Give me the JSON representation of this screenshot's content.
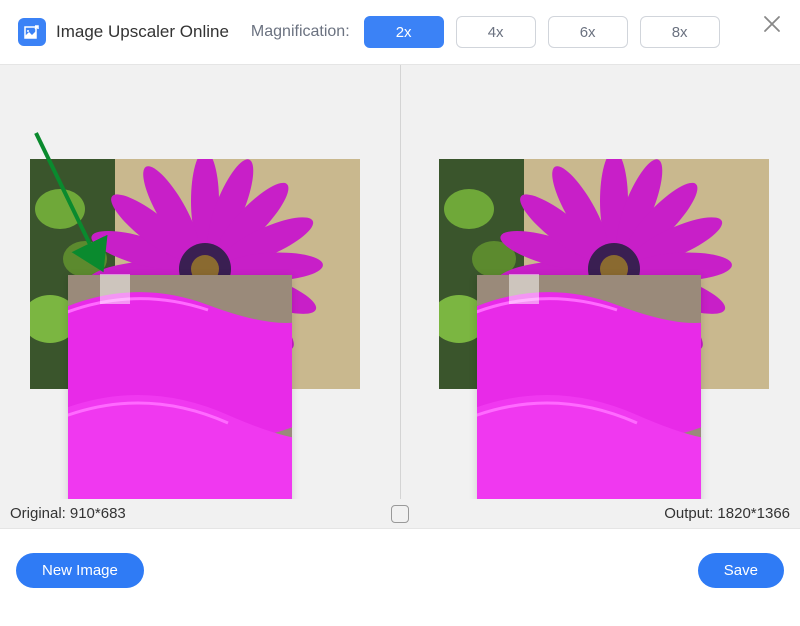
{
  "header": {
    "app_title": "Image Upscaler Online",
    "magnification_label": "Magnification:",
    "levels": [
      "2x",
      "4x",
      "6x",
      "8x"
    ],
    "active_level": "2x"
  },
  "comparison": {
    "original_label": "Original:",
    "original_size": "910*683",
    "output_label": "Output:",
    "output_size": "1820*1366"
  },
  "footer": {
    "new_image_label": "New Image",
    "save_label": "Save"
  },
  "colors": {
    "accent": "#3b82f6",
    "arrow": "#0a8a2e"
  }
}
